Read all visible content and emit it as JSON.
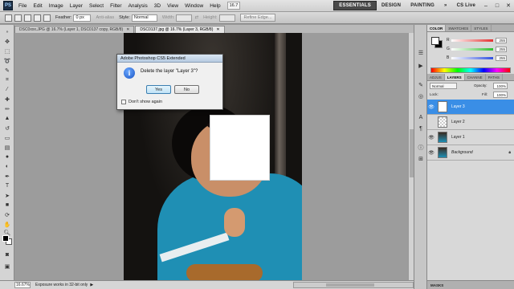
{
  "app": {
    "logo": "PS",
    "window_controls": [
      "–",
      "□",
      "✕"
    ]
  },
  "menu": [
    "File",
    "Edit",
    "Image",
    "Layer",
    "Select",
    "Filter",
    "Analysis",
    "3D",
    "View",
    "Window",
    "Help"
  ],
  "menu_zoom": "16.7",
  "workspaces": {
    "essentials": "ESSENTIALS",
    "design": "DESIGN",
    "painting": "PAINTING",
    "more": "»",
    "cs_live": "CS Live"
  },
  "options": {
    "feather_label": "Feather:",
    "feather_value": "0 px",
    "antialias_label": "Anti-alias",
    "style_label": "Style:",
    "style_value": "Normal",
    "width_label": "Width:",
    "height_label": "Height:",
    "refine_edge": "Refine Edge..."
  },
  "tabs": [
    {
      "label": "DSC0xxx.JPG @ 16.7% (Layer 1, DSC0137 copy, RGB/8)"
    },
    {
      "label": "DSC0137.jpg @ 16.7% (Layer 3, RGB/8)"
    }
  ],
  "status": {
    "zoom": "16.67%",
    "text": "Exposure works in 32-bit only"
  },
  "color_panel": {
    "tabs": [
      "COLOR",
      "SWATCHES",
      "STYLES"
    ],
    "sliders": [
      {
        "letter": "R",
        "value": "255",
        "color": "#e53030"
      },
      {
        "letter": "G",
        "value": "255",
        "color": "#30c030"
      },
      {
        "letter": "B",
        "value": "255",
        "color": "#3050e0"
      }
    ]
  },
  "layers_panel": {
    "tabs": [
      "ADJUS",
      "LAYERS",
      "CHANNE",
      "PATHS"
    ],
    "blend_mode": "Normal",
    "opacity_label": "Opacity:",
    "opacity": "100%",
    "lock_label": "Lock:",
    "fill_label": "Fill:",
    "fill": "100%",
    "layers": [
      {
        "name": "Layer 3",
        "selected": true
      },
      {
        "name": "Layer 2",
        "selected": false
      },
      {
        "name": "Layer 1",
        "selected": false
      },
      {
        "name": "Background",
        "selected": false
      }
    ],
    "masks_tab": "MASKS"
  },
  "dialog": {
    "title": "Adobe Photoshop CS5 Extended",
    "message": "Delete the layer \"Layer 3\"?",
    "yes": "Yes",
    "no": "No",
    "dont_show": "Don't show again"
  }
}
